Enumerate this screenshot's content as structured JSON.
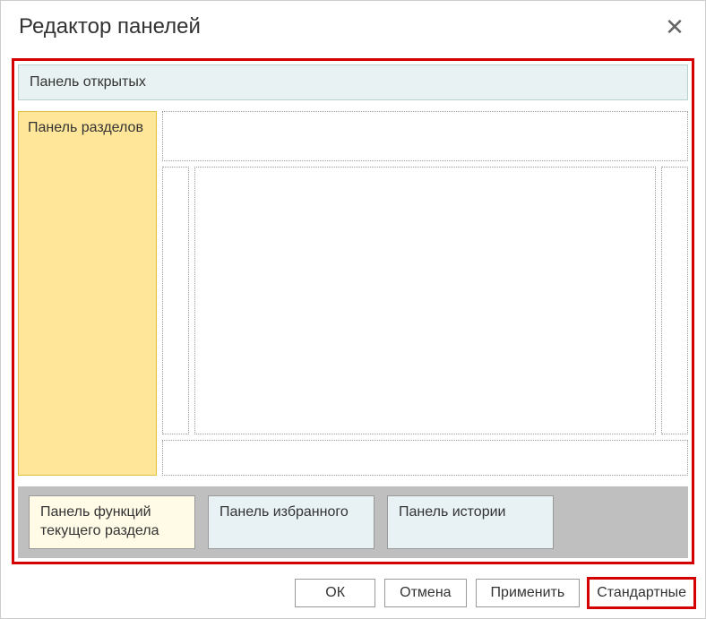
{
  "dialog": {
    "title": "Редактор панелей"
  },
  "panels": {
    "open": "Панель открытых",
    "sections": "Панель разделов"
  },
  "chips": {
    "functions": "Панель функций текущего раздела",
    "favorites": "Панель избранного",
    "history": "Панель истории"
  },
  "buttons": {
    "ok": "ОК",
    "cancel": "Отмена",
    "apply": "Применить",
    "standard": "Стандартные"
  }
}
